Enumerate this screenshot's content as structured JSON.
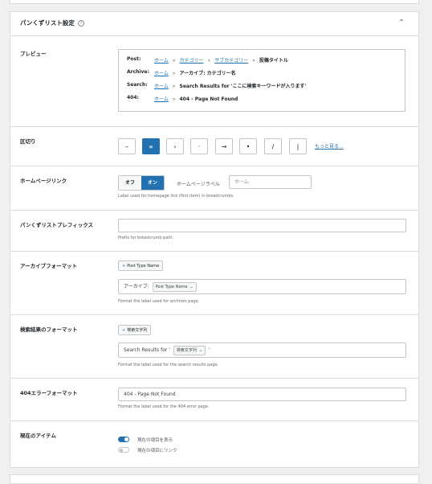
{
  "panel": {
    "title": "パンくずリスト設定",
    "help_icon": "help-circle-icon",
    "collapse_icon": "chevron-up-icon"
  },
  "preview": {
    "label": "プレビュー",
    "lines": [
      {
        "label": "Post:",
        "parts": [
          {
            "text": "ホーム",
            "link": true
          },
          {
            "sep": "»"
          },
          {
            "text": "カテゴリー",
            "link": true
          },
          {
            "sep": "»"
          },
          {
            "text": "サブカテゴリー",
            "link": true
          },
          {
            "sep": "»"
          },
          {
            "text": "投稿タイトル",
            "bold": true
          }
        ]
      },
      {
        "label": "Archive:",
        "parts": [
          {
            "text": "ホーム",
            "link": true
          },
          {
            "sep": "»"
          },
          {
            "text": "アーカイブ: カテゴリー名",
            "bold": true
          }
        ]
      },
      {
        "label": "Search:",
        "parts": [
          {
            "text": "ホーム",
            "link": true
          },
          {
            "sep": "»"
          },
          {
            "text": "Search Results for 'ここに検索キーワードが入ります'",
            "bold": true
          }
        ]
      },
      {
        "label": "404:",
        "parts": [
          {
            "text": "ホーム",
            "link": true
          },
          {
            "sep": "»"
          },
          {
            "text": "404 - Page Not Found",
            "bold": true
          }
        ]
      }
    ]
  },
  "separator": {
    "label": "区切り",
    "options": [
      "–",
      "»",
      "›",
      "·",
      "→",
      "•",
      "/",
      "|"
    ],
    "active_index": 1,
    "more_link": "もっと見る..."
  },
  "homepage_link": {
    "label": "ホームページリンク",
    "off": "オフ",
    "on": "オン",
    "field_label": "ホームページラベル",
    "placeholder": "ホーム",
    "description": "Label used for homepage link (first item) in breadcrumbs."
  },
  "prefix": {
    "label": "パンくずリストプレフィックス",
    "value": "",
    "description": "Prefix for breadcrumb path."
  },
  "archive_format": {
    "label": "アーカイブフォーマット",
    "chip": "Post Type Name",
    "input_prefix": "アーカイブ:",
    "select": "Post Type Name",
    "description": "Format the label used for archives page."
  },
  "search_format": {
    "label": "検索結果のフォーマット",
    "chip": "検索文字列",
    "input_prefix": "Search Results for '",
    "select": "検索文字列",
    "input_suffix": "'",
    "description": "Format the label used for the search results page."
  },
  "error_format": {
    "label": "404エラーフォーマット",
    "value": "404 - Page Not Found",
    "description": "Format the label used for the 404 error page."
  },
  "current_item": {
    "label": "現在のアイテム",
    "toggles": [
      {
        "label": "現在の項目を表示",
        "on": true
      },
      {
        "label": "現在の項目にリンク",
        "on": false
      }
    ]
  },
  "colors": {
    "accent": "#2271b1",
    "border": "#dcdcde",
    "background": "#f0f0f1"
  }
}
